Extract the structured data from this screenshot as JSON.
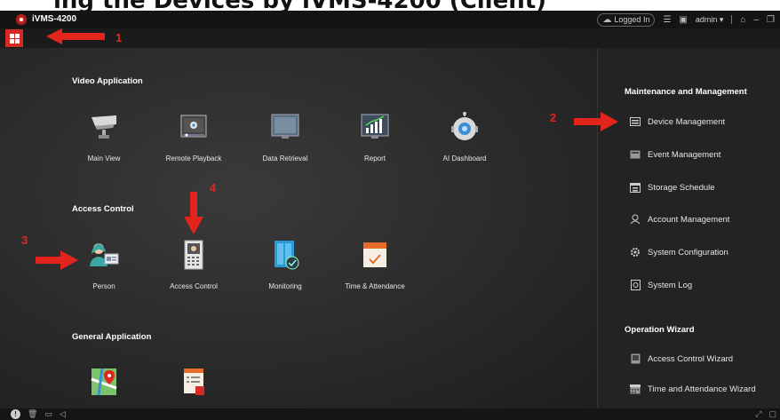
{
  "heading_fragment": "ing the Devices by iVMS-4200 (Client)",
  "app": {
    "title": "iVMS-4200"
  },
  "titlebar": {
    "logged_in": "Logged In",
    "user": "admin"
  },
  "main": {
    "sections": [
      {
        "title": "Video Application",
        "items": [
          "Main View",
          "Remote Playback",
          "Data Retrieval",
          "Report",
          "AI Dashboard"
        ]
      },
      {
        "title": "Access Control",
        "items": [
          "Person",
          "Access Control",
          "Monitoring",
          "Time & Attendance"
        ]
      },
      {
        "title": "General Application",
        "items": [
          "",
          ""
        ]
      }
    ]
  },
  "sidebar": {
    "maintenance_title": "Maintenance and Management",
    "maintenance_items": [
      "Device Management",
      "Event Management",
      "Storage Schedule",
      "Account Management",
      "System Configuration",
      "System Log"
    ],
    "wizard_title": "Operation Wizard",
    "wizard_items": [
      "Access Control Wizard",
      "Time and Attendance Wizard"
    ]
  },
  "callouts": [
    "1",
    "2",
    "3",
    "4"
  ],
  "colors": {
    "accent": "#d62a24",
    "callout": "#e3241d",
    "background": "#2a2a2a"
  }
}
